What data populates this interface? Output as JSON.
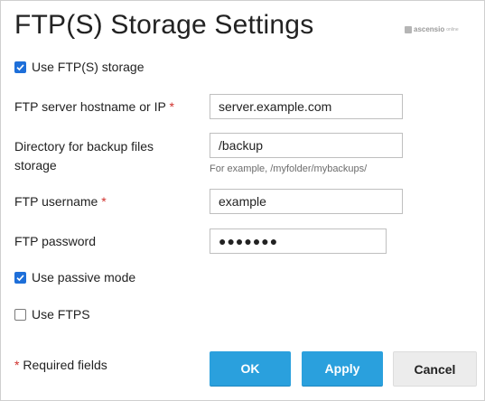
{
  "dialog": {
    "title": "FTP(S) Storage Settings",
    "brand": {
      "name": "ascensio",
      "suffix": "online"
    }
  },
  "form": {
    "use_ftp": {
      "label": "Use FTP(S) storage",
      "checked": true
    },
    "hostname": {
      "label": "FTP server hostname or IP",
      "required_mark": "*",
      "value": "server.example.com"
    },
    "directory": {
      "label_line1": "Directory for backup files",
      "label_line2": "storage",
      "value": "/backup",
      "hint": "For example, /myfolder/mybackups/"
    },
    "username": {
      "label": "FTP username",
      "required_mark": "*",
      "value": "example"
    },
    "password": {
      "label": "FTP password",
      "masked_value": "●●●●●●●"
    },
    "passive": {
      "label": "Use passive mode",
      "checked": true
    },
    "ftps": {
      "label": "Use FTPS",
      "checked": false
    }
  },
  "footer": {
    "required_mark": "*",
    "required_note": "Required fields",
    "ok_label": "OK",
    "apply_label": "Apply",
    "cancel_label": "Cancel"
  },
  "colors": {
    "accent": "#2aa0dd",
    "checkbox": "#1e6fd9",
    "required": "#d0312d"
  }
}
